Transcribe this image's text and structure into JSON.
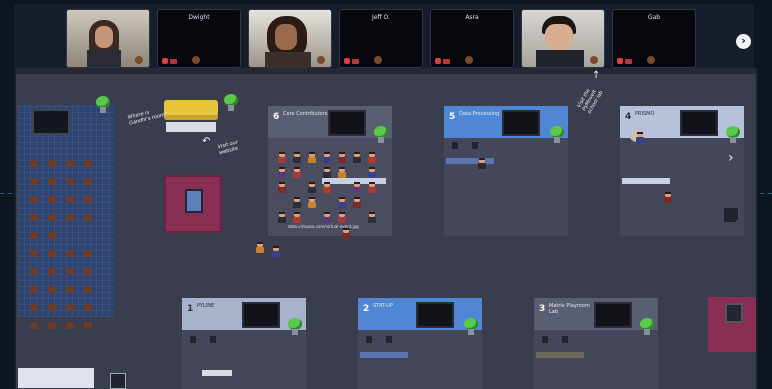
{
  "video_tiles": [
    {
      "name": "",
      "kind": "camera-woman"
    },
    {
      "name": "Dwight",
      "kind": "off"
    },
    {
      "name": "",
      "kind": "camera-man"
    },
    {
      "name": "Jeff O.",
      "kind": "off"
    },
    {
      "name": "Asra",
      "kind": "off"
    },
    {
      "name": "",
      "kind": "camera-man2"
    },
    {
      "name": "Gab",
      "kind": "off"
    }
  ],
  "next_label": "›",
  "map": {
    "notes": {
      "where_note": "Where is Gandhi's room?",
      "visit_note": "Visit our website",
      "pymoveit_note": "Visit the PyMoveIt school lab"
    },
    "rooms": [
      {
        "number": "6",
        "label": "Core Contributors",
        "color": "#4a4d60"
      },
      {
        "number": "5",
        "label": "Data Processing",
        "color": "#4f87d4"
      },
      {
        "number": "4",
        "label": "PRISMO",
        "color": "#b6c2dc"
      },
      {
        "number": "1",
        "label": "PYLINE",
        "color": "#a7b3cc"
      },
      {
        "number": "2",
        "label": "STAT-UP",
        "color": "#4f87d4"
      },
      {
        "number": "3",
        "label": "Matrix Playroom Lab",
        "color": "#4a4d60"
      }
    ],
    "stage_caption": "data.virtuoso.com/virtual-event.jpg"
  },
  "colors": {
    "accent": "#4f87d4",
    "plant": "#59c94a",
    "rug": "#8a2f54",
    "sofa": "#e8c43a"
  }
}
